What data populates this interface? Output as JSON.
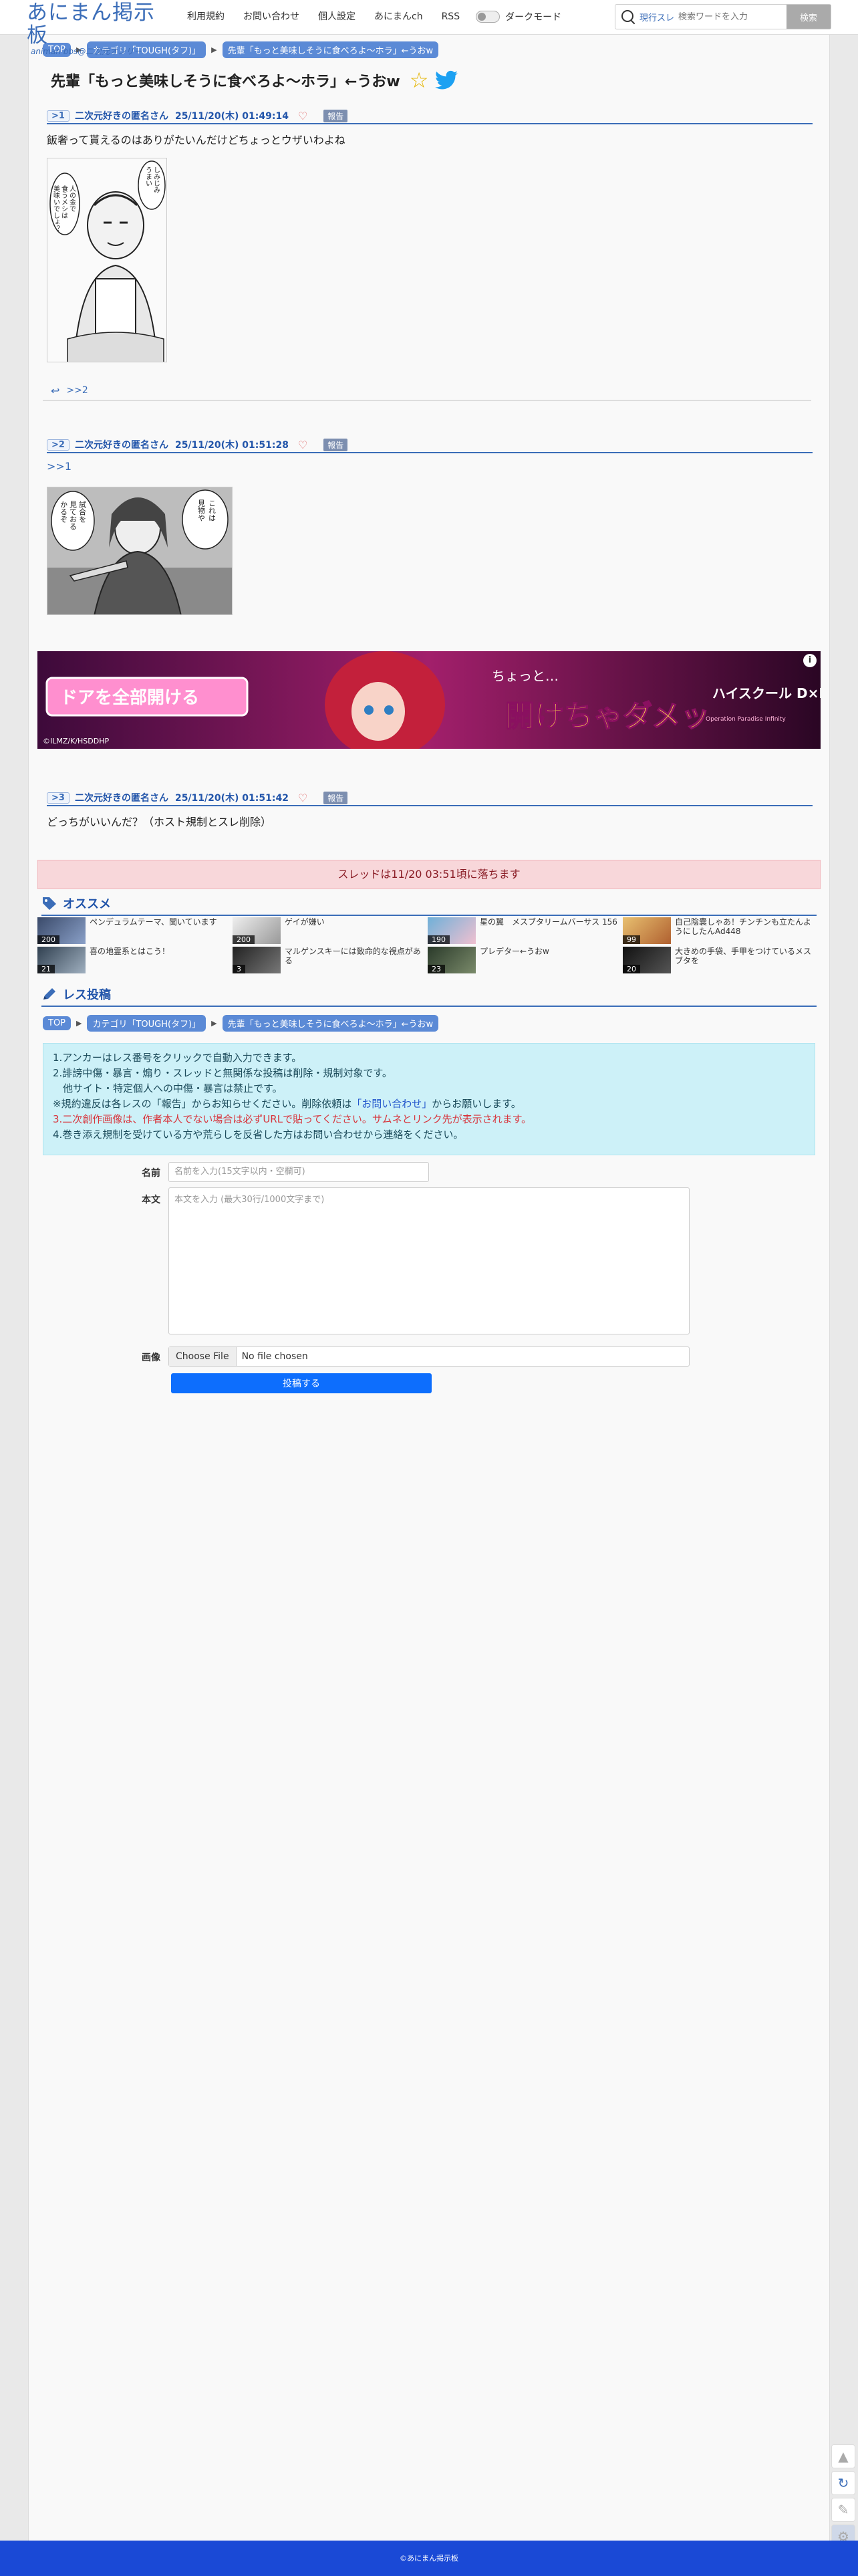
{
  "header": {
    "logo_main": "あにまん掲示板",
    "logo_sub": "animan bbs@二次元オンリー",
    "nav": [
      "利用規約",
      "お問い合わせ",
      "個人設定",
      "あにまんch",
      "RSS"
    ],
    "dark_mode_label": "ダークモード",
    "search_scope": "現行スレ",
    "search_placeholder": "検索ワードを入力",
    "search_button": "検索"
  },
  "breadcrumb": [
    "TOP",
    "カテゴリ「TOUGH(タフ)」",
    "先輩「もっと美味しそうに食べろよ～ホラ」←うおw"
  ],
  "thread": {
    "title": "先輩「もっと美味しそうに食べろよ～ホラ」←うおw"
  },
  "posts": [
    {
      "num": ">1",
      "name": "二次元好きの匿名さん",
      "date": "25/11/20(木) 01:49:14",
      "report": "報告",
      "body": "飯奢って貰えるのはありがたいんだけどちょっとウザいわよね",
      "image_speech": [
        "人の金で",
        "食うメシは",
        "美味いでしょ？",
        "しみじみ",
        "うまい"
      ]
    },
    {
      "num": ">2",
      "name": "二次元好きの匿名さん",
      "date": "25/11/20(木) 01:51:28",
      "report": "報告",
      "anchor": ">>1",
      "image_speech": [
        "試合を",
        "見ておる",
        "かるぞ",
        "これは",
        "見物や"
      ]
    },
    {
      "num": ">3",
      "name": "二次元好きの匿名さん",
      "date": "25/11/20(木) 01:51:42",
      "report": "報告",
      "body": "どっちがいいんだ？（ホスト規制とスレ削除）"
    }
  ],
  "reply_link": ">>2",
  "ad": {
    "left_text": "ドアを全部開ける",
    "bottom_text": "©ILMZ/K/HSDDHP",
    "middle_text": "ちょっと…",
    "big_text": "開けちゃダメッ",
    "logo_text": "ハイスクール D×D",
    "logo_sub": "Operation Paradise Infinity",
    "info": "i"
  },
  "expire_notice": "スレッドは11/20 03:51頃に落ちます",
  "recommended": {
    "title": "オススメ",
    "items": [
      {
        "title": "ペンデュラムテーマ、聞いています",
        "count": "200"
      },
      {
        "title": "ゲイが嫌い",
        "count": "200"
      },
      {
        "title": "星の翼　メスブタリームバーサス 156",
        "count": "190"
      },
      {
        "title": "自己陰嚢しゃあ！チンチンも立たんようにしたんAd448",
        "count": "99"
      },
      {
        "title": "喜の地霊系とはこう！",
        "count": "21"
      },
      {
        "title": "マルゲンスキーには致命的な視点がある",
        "count": "3"
      },
      {
        "title": "プレデター←うおw",
        "count": "23"
      },
      {
        "title": "大きめの手袋、手甲をつけているメスブタを",
        "count": "20"
      }
    ]
  },
  "post_form": {
    "title": "レス投稿",
    "rules": [
      "1.アンカーはレス番号をクリックで自動入力できます。",
      "2.誹謗中傷・暴言・煽り・スレッドと無関係な投稿は削除・規制対象です。",
      "　他サイト・特定個人への中傷・暴言は禁止です。",
      "※規約違反は各レスの「報告」からお知らせください。削除依頼は",
      "「お問い合わせ」",
      "からお願いします。",
      "3.二次創作画像は、作者本人でない場合は必ずURLで貼ってください。サムネとリンク先が表示されます。",
      "4.巻き添え規制を受けている方や荒らしを反省した方はお問い合わせから連絡をください。"
    ],
    "name_label": "名前",
    "name_placeholder": "名前を入力(15文字以内・空欄可)",
    "body_label": "本文",
    "body_placeholder": "本文を入力 (最大30行/1000文字まで)",
    "image_label": "画像",
    "file_button": "Choose File",
    "file_status": "No file chosen",
    "submit": "投稿する"
  },
  "footer": "©あにまん掲示板",
  "colors": {
    "accent": "#3b6db8",
    "crumb": "#5b8ad6",
    "footer": "#1a49d6",
    "expire_bg": "#f8d7da",
    "rules_bg": "#cdf1f8",
    "submit": "#0d6efd"
  }
}
